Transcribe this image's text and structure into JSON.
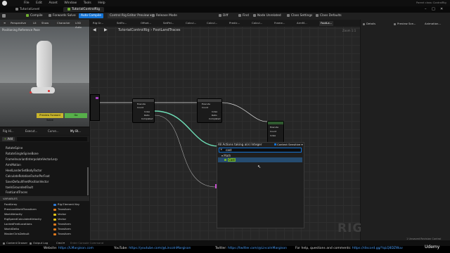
{
  "menu_bar": [
    "File",
    "Edit",
    "Asset",
    "Window",
    "Tools",
    "Help"
  ],
  "project_badge": "Parent class: ControlRig",
  "tabs": [
    "TutorialLevel",
    "TutorialControlRig"
  ],
  "toolbar": {
    "compile": "Compile",
    "forwards_solve": "Forwards Solve",
    "auto_compile": "Auto Compile",
    "preview": "Control Rig Editor Preview",
    "release_mode": "Release Mode",
    "diff": "Diff",
    "find": "Find",
    "node_unrelated": "Node Unrelated",
    "class_settings": "Class Settings",
    "class_defaults": "Class Defaults"
  },
  "viewport": {
    "buttons": [
      "Perspective",
      "Lit",
      "Show",
      "Character",
      "LOD Auto"
    ],
    "label": "Positioning Reference Pose",
    "btn_preview": "Preview Forward Solve",
    "btn_go": "Go"
  },
  "left_tabs": [
    "Rig Hi...",
    "Execut...",
    "Curve...",
    "My Bl..."
  ],
  "add_label": "Add",
  "functions": [
    "RotateSpine",
    "RotateSingleSpineBone",
    "FrameInvariantInterpolateVectorLerp",
    "ArmMotion",
    "HeelLanderSetBodyFactor",
    "CalculateRotationFactorPerFoot",
    "SaveDefaultFeetPositionVector",
    "toeIsGroundedFault",
    "FootLandTraces"
  ],
  "variables_header": "VARIABLES",
  "variables": [
    {
      "name": "FootArray",
      "type": "Rig Element Key",
      "color": "#2d79d6"
    },
    {
      "name": "PreviousWorldTransform",
      "type": "Transform",
      "color": "#e07a1c"
    },
    {
      "name": "WorldVelocity",
      "type": "Vector",
      "color": "#e2c416"
    },
    {
      "name": "RigSpeedCalculatedVelocity",
      "type": "Vector",
      "color": "#e2c416"
    },
    {
      "name": "LockedFeetLocations",
      "type": "Transform",
      "color": "#e07a1c"
    },
    {
      "name": "WorldDelta",
      "type": "Transform",
      "color": "#e07a1c"
    },
    {
      "name": "MasterCtrlsDefault",
      "type": "Transform",
      "color": "#e07a1c"
    }
  ],
  "function_tabs": [
    "Rig Gr...",
    "SetFo...",
    "Offset...",
    "SetPel...",
    "Calcul...",
    "Calcul...",
    "Predic...",
    "Calcul...",
    "Frame...",
    "ArmM...",
    "FootLa..."
  ],
  "breadcrumb": {
    "root": "TutorialControlRig",
    "sep": "›",
    "leaf": "FootLandTraces"
  },
  "zoom": "Zoom 1:1",
  "nodes": {
    "n1_pins": [
      "Execute",
      "Count",
      "Index",
      "Ratio",
      "Completed"
    ],
    "n2_pins": [
      "Execute",
      "Count",
      "Index",
      "Ratio",
      "Completed"
    ],
    "n3_pins": [
      "Execute",
      "Count",
      "Index"
    ]
  },
  "rig_watermark": "RIG",
  "action_menu": {
    "title": "All Actions taking a(n) Integer",
    "context_sensitive": "Context Sensitive",
    "search_value": "cast",
    "category": "Math",
    "item": "Cast"
  },
  "right_tabs": [
    "Details",
    "Preview Sce...",
    "Animation..."
  ],
  "ue_version": "1 Unsaved  Revision Control",
  "status_bar": [
    "Content Drawer",
    "Output Log",
    "Cmd",
    "Enter Console Command"
  ],
  "footer": {
    "website_label": "Website:",
    "website": "https://LMargison.com",
    "youtube_label": "YouTube:",
    "youtube": "https://youtube.com/@LincolnMargison",
    "twitter_label": "Twitter:",
    "twitter": "https://twitter.com/@LincolnMargison",
    "help_label": "For help, questions and comments:",
    "discord": "https://discord.gg/YqLQ8DZWuv",
    "brand": "Udemy"
  }
}
